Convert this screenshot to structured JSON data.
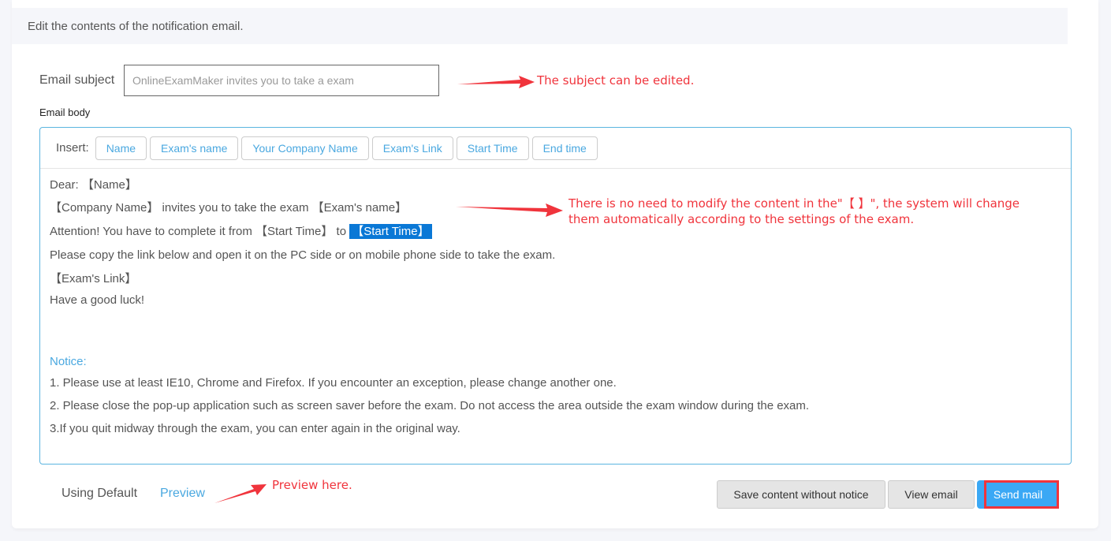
{
  "header": {
    "title": "Edit the contents of the notification email."
  },
  "subject": {
    "label": "Email subject",
    "value": "",
    "placeholder": "OnlineExamMaker invites you to take a exam"
  },
  "body": {
    "label": "Email body",
    "insert_label": "Insert:",
    "insert_buttons": [
      "Name",
      "Exam's name",
      "Your Company Name",
      "Exam's Link",
      "Start Time",
      "End time"
    ],
    "lines": {
      "dear": "Dear: ",
      "dear_tag": "【Name】",
      "company_tag": "【Company Name】",
      "invites": " invites you to take the exam ",
      "exam_tag": "【Exam's name】",
      "attention": "Attention! You have to complete it from ",
      "start_tag": "【Start Time】",
      "to": " to ",
      "end_tag_selected": "【Start Time】",
      "copy_link": "Please copy the link below and open it on the PC side or on mobile phone side to take the exam.",
      "link_tag": "【Exam's Link】",
      "good_luck": "Have a good luck!"
    },
    "notice_title": "Notice:",
    "notice_items": [
      "1. Please use at least IE10, Chrome and Firefox. If you encounter an exception, please change another one.",
      "2. Please close the pop-up application such as screen saver before the exam. Do not access the area outside the exam window during the exam.",
      "3.If you quit midway through the exam, you can enter again in the original way."
    ]
  },
  "footer": {
    "using_default": "Using Default",
    "preview": "Preview",
    "buttons": {
      "save": "Save content without notice",
      "view": "View email",
      "send": "Send mail"
    }
  },
  "annotations": {
    "subject_note": "The subject can be edited.",
    "brackets_note_line1": "There is no need to modify the content in the\"【 】\", the system will change",
    "brackets_note_line2": "them automatically according to the settings of the exam.",
    "preview_note": "Preview here."
  },
  "colors": {
    "accent": "#4aa8e0",
    "primary_button": "#3aa8f5",
    "annotation": "#f0343c",
    "selection": "#0a78d6"
  }
}
